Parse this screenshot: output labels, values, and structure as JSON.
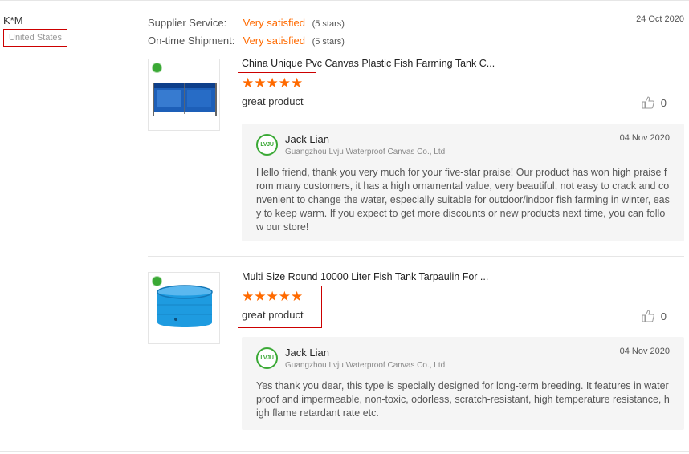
{
  "reviewer": {
    "name": "K*M",
    "country": "United States"
  },
  "ratings": [
    {
      "label": "Supplier Service:",
      "value": "Very satisfied",
      "stars": "(5 stars)"
    },
    {
      "label": "On-time Shipment:",
      "value": "Very satisfied",
      "stars": "(5 stars)"
    }
  ],
  "date": "24 Oct 2020",
  "products": [
    {
      "title": "China Unique Pvc Canvas Plastic Fish Farming Tank C...",
      "stars": "★★★★★",
      "rating": 5,
      "review": "great product",
      "likes": "0",
      "reply": {
        "avatar_text": "LVJU",
        "name": "Jack Lian",
        "company": "Guangzhou Lvju Waterproof Canvas Co., Ltd.",
        "date": "04 Nov 2020",
        "text": "Hello friend, thank you very much for your five-star praise! Our product has won high praise from many customers, it has a high ornamental value, very beautiful, not easy to crack and convenient to change the water, especially suitable for outdoor/indoor fish farming in winter, easy to keep warm. If you expect to get more discounts or new products next time, you can follow our store!"
      }
    },
    {
      "title": "Multi Size Round 10000 Liter Fish Tank Tarpaulin For ...",
      "stars": "★★★★★",
      "rating": 5,
      "review": "great product",
      "likes": "0",
      "reply": {
        "avatar_text": "LVJU",
        "name": "Jack Lian",
        "company": "Guangzhou Lvju Waterproof Canvas Co., Ltd.",
        "date": "04 Nov 2020",
        "text": "Yes thank you dear, this type is specially designed for long-term breeding. It features in waterproof and impermeable, non-toxic, odorless, scratch-resistant, high temperature resistance, high flame retardant rate etc."
      }
    }
  ],
  "colors": {
    "accent": "#ff6a00",
    "highlight_border": "#cc0000",
    "brand_green": "#3aa935"
  },
  "icons": {
    "like": "thumbs-up-icon",
    "avatar": "company-logo-icon",
    "thumb_badge": "verified-badge-icon"
  }
}
